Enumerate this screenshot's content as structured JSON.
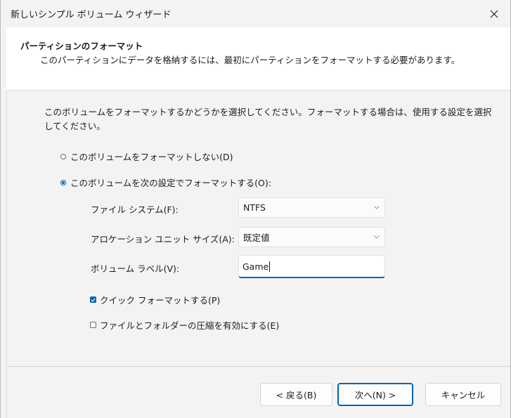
{
  "window": {
    "title": "新しいシンプル ボリューム ウィザード"
  },
  "header": {
    "title": "パーティションのフォーマット",
    "subtitle": "このパーティションにデータを格納するには、最初にパーティションをフォーマットする必要があります。"
  },
  "main": {
    "instructions": "このボリュームをフォーマットするかどうかを選択してください。フォーマットする場合は、使用する設定を選択してください。",
    "radio_no_format": {
      "label": "このボリュームをフォーマットしない(D)",
      "checked": false
    },
    "radio_format": {
      "label": "このボリュームを次の設定でフォーマットする(O):",
      "checked": true
    },
    "file_system": {
      "label": "ファイル システム(F):",
      "value": "NTFS"
    },
    "allocation_unit": {
      "label": "アロケーション ユニット サイズ(A):",
      "value": "既定値"
    },
    "volume_label": {
      "label": "ボリューム ラベル(V):",
      "value": "Game"
    },
    "quick_format": {
      "label": "クイック フォーマットする(P)",
      "checked": true
    },
    "compression": {
      "label": "ファイルとフォルダーの圧縮を有効にする(E)",
      "checked": false
    }
  },
  "buttons": {
    "back": "< 戻る(B)",
    "next": "次へ(N) >",
    "cancel": "キャンセル"
  },
  "colors": {
    "accent": "#0063b1",
    "window_bg": "#f3f3f3",
    "header_bg": "#ffffff"
  },
  "icons": {
    "close": "close-icon",
    "dropdown": "chevron-down-icon",
    "check": "checkmark-icon"
  }
}
